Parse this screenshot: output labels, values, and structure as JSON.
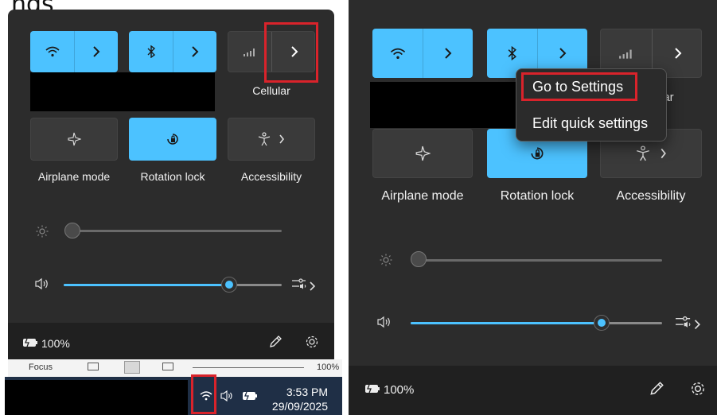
{
  "header_fragment": "ngs",
  "left_panel": {
    "tiles": {
      "wifi": {
        "icon": "wifi-icon",
        "chevron": "chevron-right-icon"
      },
      "bluetooth": {
        "icon": "bluetooth-icon",
        "chevron": "chevron-right-icon"
      },
      "cellular": {
        "icon": "cellular-signal-icon",
        "chevron": "chevron-right-icon",
        "label": "Cellular"
      },
      "airplane": {
        "icon": "airplane-icon",
        "label": "Airplane mode"
      },
      "rotation": {
        "icon": "rotation-lock-icon",
        "label": "Rotation lock"
      },
      "accessibility": {
        "icon": "accessibility-icon",
        "chevron": "chevron-right-icon",
        "label": "Accessibility"
      }
    },
    "brightness": {
      "icon": "brightness-icon",
      "level": 0
    },
    "volume": {
      "icon": "speaker-icon",
      "level": 0.76
    },
    "footer": {
      "battery_icon": "battery-charging-icon",
      "battery_text": "100%",
      "edit_icon": "pencil-icon",
      "settings_icon": "gear-icon"
    }
  },
  "word_statusbar": {
    "focus": "Focus",
    "zoom": "100%"
  },
  "taskbar": {
    "time": "3:53 PM",
    "date": "29/09/2025",
    "icons": [
      "wifi-icon",
      "speaker-icon",
      "battery-charging-icon"
    ]
  },
  "right_panel": {
    "tiles": {
      "cellular_partial_label": "ar",
      "airplane": {
        "label": "Airplane mode"
      },
      "rotation": {
        "label": "Rotation lock"
      },
      "accessibility": {
        "label": "Accessibility"
      }
    },
    "brightness": {
      "level": 0
    },
    "volume": {
      "level": 0.76
    },
    "footer": {
      "battery_text": "100%"
    }
  },
  "context_menu": {
    "items": [
      "Go to Settings",
      "Edit quick settings"
    ]
  },
  "colors": {
    "accent": "#4cc2ff",
    "highlight": "#d9232b",
    "panel": "#2c2c2c"
  }
}
